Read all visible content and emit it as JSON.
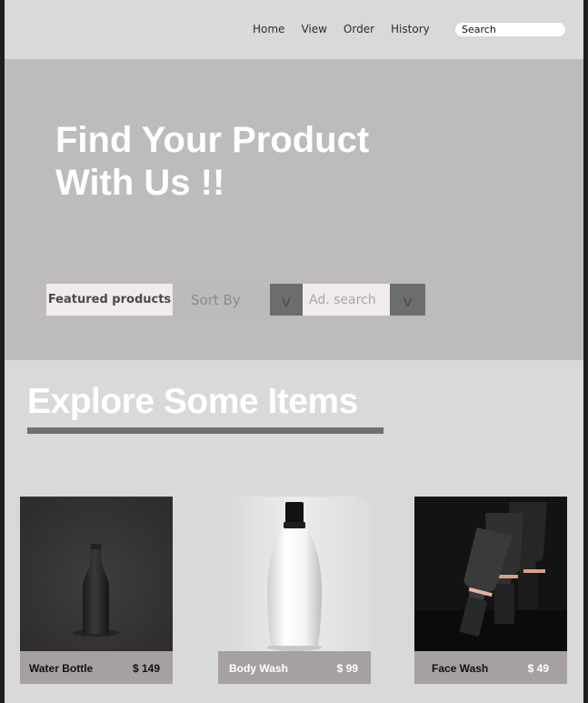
{
  "nav": {
    "items": [
      "Home",
      "View",
      "Order",
      "History"
    ],
    "search_placeholder": "Search"
  },
  "hero": {
    "title_line1": "Find Your Product",
    "title_line2": "With Us !!",
    "filters": {
      "featured": "Featured products",
      "sort": "Sort By",
      "advanced": "Ad.  search",
      "chevron": "v"
    }
  },
  "explore": {
    "title": "Explore Some Items"
  },
  "products": [
    {
      "name": "Water Bottle",
      "price": "$ 149",
      "image_icon": "water-bottle-icon"
    },
    {
      "name": "Body Wash",
      "price": "$  99",
      "image_icon": "body-wash-bottle-icon"
    },
    {
      "name": "Face Wash",
      "price": "$ 49",
      "image_icon": "face-wash-tubes-icon"
    }
  ],
  "colors": {
    "header_bg": "#d9d9d9",
    "hero_bg": "#bebbbc",
    "dark_chip": "#6e6d6e",
    "light_chip": "#f1ebeb",
    "card_bar": "#a7a0a0"
  }
}
